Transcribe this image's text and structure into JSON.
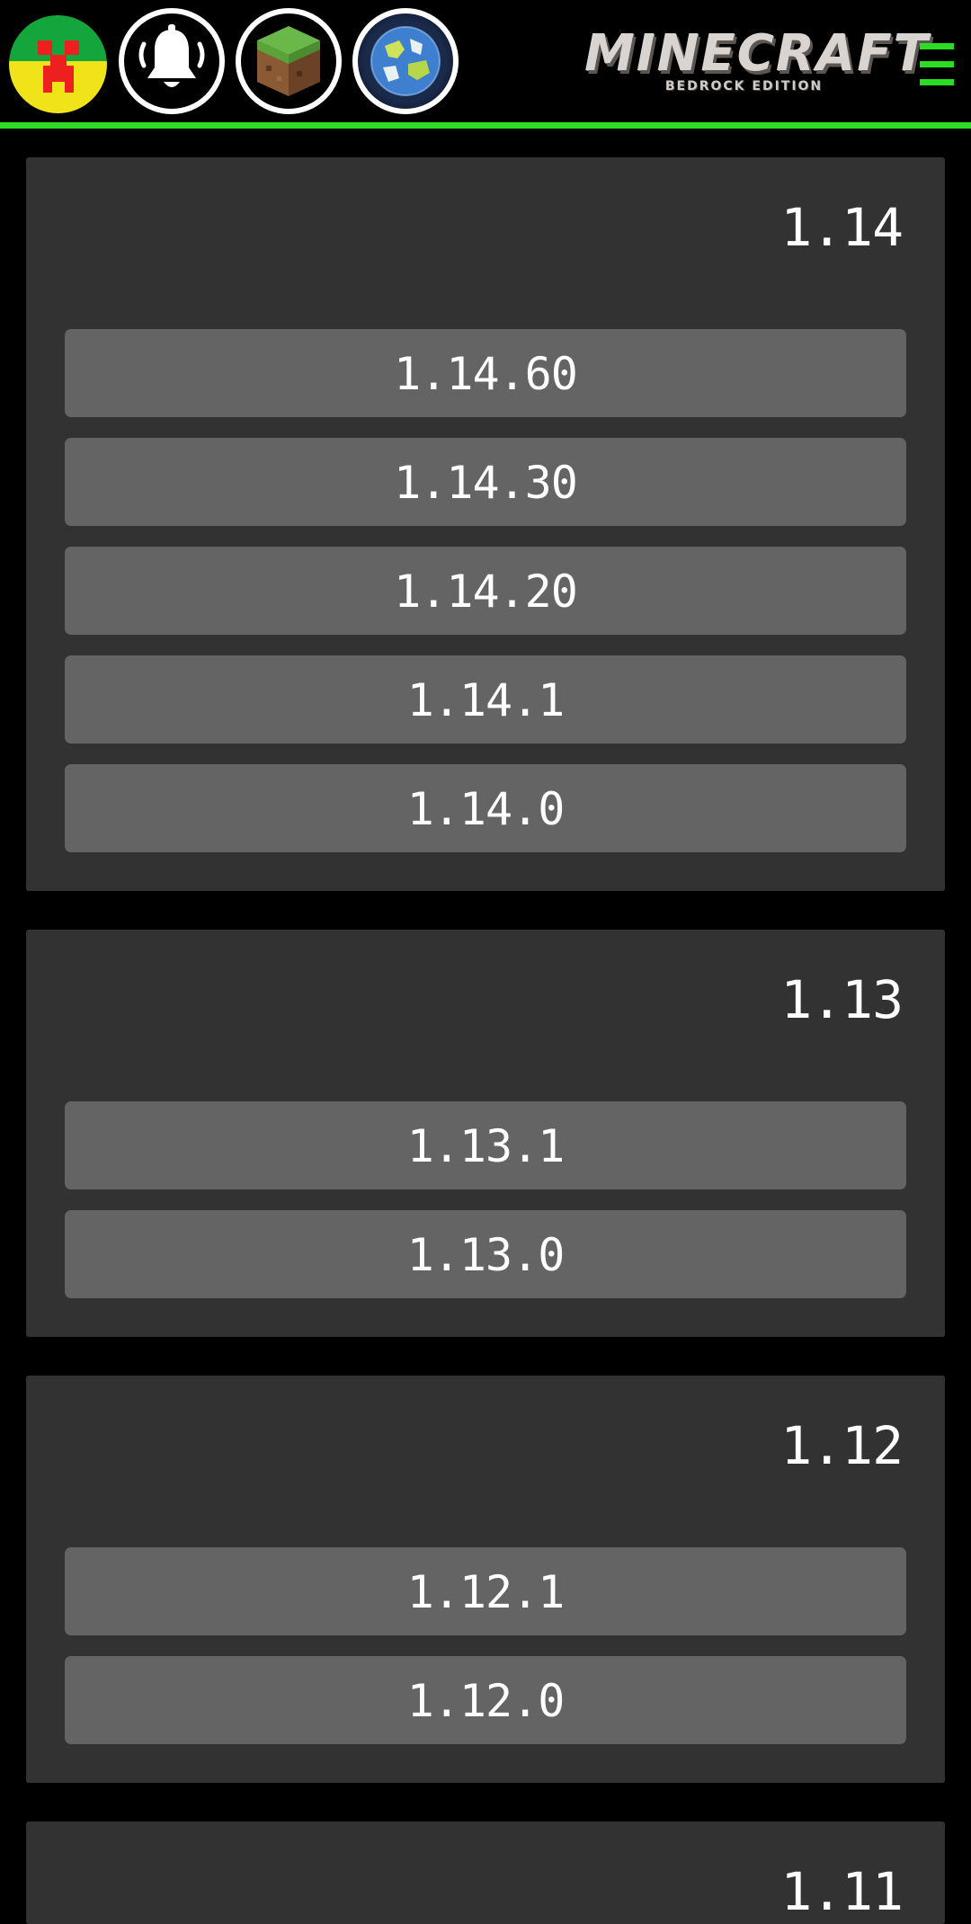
{
  "header": {
    "logo_title": "MINECRAFT",
    "logo_subtitle": "BEDROCK EDITION",
    "accent_color": "#2bdc22",
    "icons": [
      "creeper-avatar-icon",
      "bell-icon",
      "grass-block-icon",
      "planet-icon",
      "hamburger-menu-icon"
    ]
  },
  "sections": [
    {
      "title": "1.14",
      "versions": [
        "1.14.60",
        "1.14.30",
        "1.14.20",
        "1.14.1",
        "1.14.0"
      ]
    },
    {
      "title": "1.13",
      "versions": [
        "1.13.1",
        "1.13.0"
      ]
    },
    {
      "title": "1.12",
      "versions": [
        "1.12.1",
        "1.12.0"
      ]
    },
    {
      "title": "1.11",
      "versions": []
    }
  ]
}
